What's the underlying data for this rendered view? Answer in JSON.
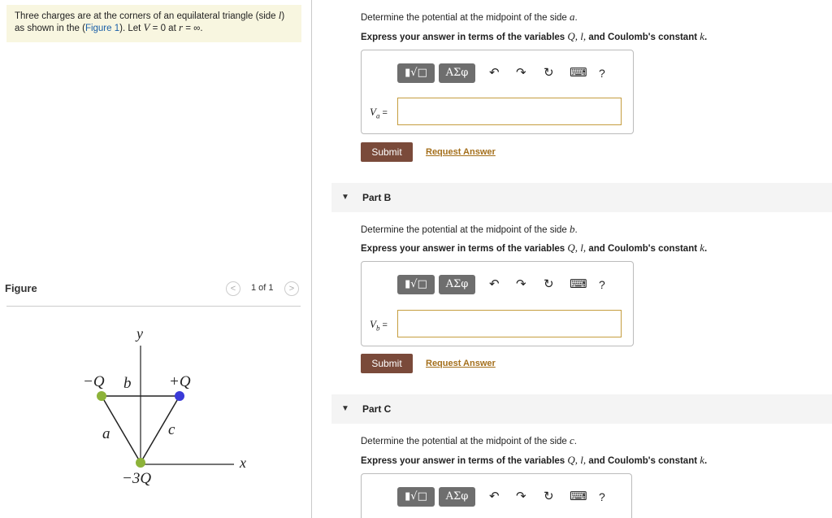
{
  "problem": {
    "line1": "Three charges are at the corners of an equilateral triangle (side ",
    "side_var": "l",
    "line1_end": ")",
    "line2_start": "as shown in the (",
    "figure_link": "Figure 1",
    "line2_mid": "). Let ",
    "v_var": "V",
    "eq1": " = 0 at ",
    "r_var": "r",
    "eq2": " = ∞."
  },
  "figure": {
    "label": "Figure",
    "pager": "1 of 1",
    "prev_icon": "chevron-left",
    "next_icon": "chevron-right",
    "axis_y": "y",
    "axis_x": "x",
    "charge_tl": "−Q",
    "charge_tr": "+Q",
    "charge_bottom": "−3Q",
    "side_b": "b",
    "side_a": "a",
    "side_c": "c",
    "colors": {
      "green": "#8db33a",
      "blue": "#3a3ad8"
    }
  },
  "parts": [
    {
      "head": "",
      "question_pre": "Determine the potential at the midpoint of the side ",
      "side": "a",
      "question_post": ".",
      "instruction": "Express your answer in terms of the variables ",
      "vars": "Q, l,",
      "instruction_mid": " and Coulomb's constant ",
      "k": "k",
      "instruction_end": ".",
      "var_label": "V",
      "var_sub": "a",
      "submit": "Submit",
      "request": "Request Answer"
    },
    {
      "head": "Part B",
      "question_pre": "Determine the potential at the midpoint of the side ",
      "side": "b",
      "question_post": ".",
      "instruction": "Express your answer in terms of the variables ",
      "vars": "Q, l,",
      "instruction_mid": " and Coulomb's constant ",
      "k": "k",
      "instruction_end": ".",
      "var_label": "V",
      "var_sub": "b",
      "submit": "Submit",
      "request": "Request Answer"
    },
    {
      "head": "Part C",
      "question_pre": "Determine the potential at the midpoint of the side ",
      "side": "c",
      "question_post": ".",
      "instruction": "Express your answer in terms of the variables ",
      "vars": "Q, l,",
      "instruction_mid": " and Coulomb's constant ",
      "k": "k",
      "instruction_end": "."
    }
  ],
  "toolbar": {
    "templates": "▮√□",
    "greek": "ΑΣφ",
    "undo": "↶",
    "redo": "↷",
    "reset": "↻",
    "keyboard": "⌨",
    "help": "?"
  }
}
